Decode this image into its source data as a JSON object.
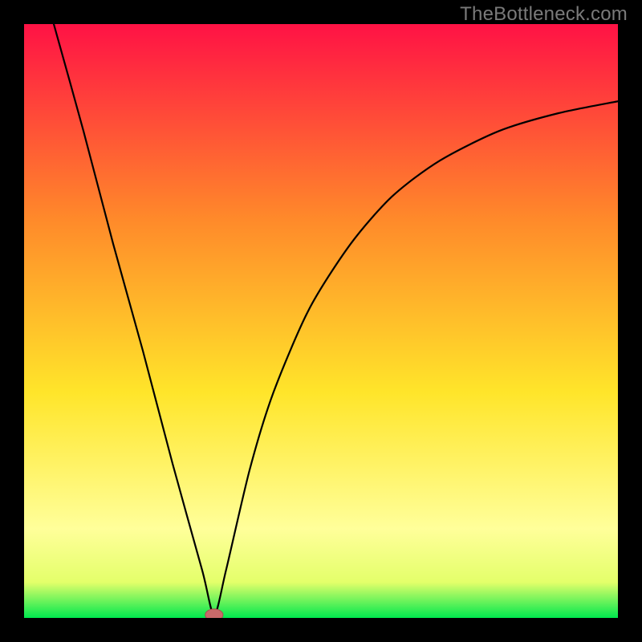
{
  "watermark": "TheBottleneck.com",
  "chart_data": {
    "type": "line",
    "title": "",
    "xlabel": "",
    "ylabel": "",
    "xlim": [
      0,
      100
    ],
    "ylim": [
      0,
      100
    ],
    "colors": {
      "gradient_top": "#ff1245",
      "gradient_upper_mid": "#ff8a2a",
      "gradient_mid": "#ffe52a",
      "gradient_lower_mid": "#e4ff6a",
      "gradient_bottom": "#00e84e",
      "curve": "#000000",
      "marker_fill": "#c96a6a",
      "marker_stroke": "#aa4f4f",
      "frame": "#000000"
    },
    "marker": {
      "x": 32,
      "y": 0.5,
      "rx": 1.5,
      "ry": 1.0
    },
    "series": [
      {
        "name": "bottleneck-curve",
        "points": [
          {
            "x": 5,
            "y": 100
          },
          {
            "x": 10,
            "y": 82
          },
          {
            "x": 15,
            "y": 63
          },
          {
            "x": 20,
            "y": 45
          },
          {
            "x": 25,
            "y": 26
          },
          {
            "x": 30,
            "y": 8
          },
          {
            "x": 32,
            "y": 0.5
          },
          {
            "x": 34,
            "y": 8
          },
          {
            "x": 38,
            "y": 25
          },
          {
            "x": 42,
            "y": 38
          },
          {
            "x": 48,
            "y": 52
          },
          {
            "x": 55,
            "y": 63
          },
          {
            "x": 62,
            "y": 71
          },
          {
            "x": 70,
            "y": 77
          },
          {
            "x": 80,
            "y": 82
          },
          {
            "x": 90,
            "y": 85
          },
          {
            "x": 100,
            "y": 87
          }
        ]
      }
    ]
  }
}
